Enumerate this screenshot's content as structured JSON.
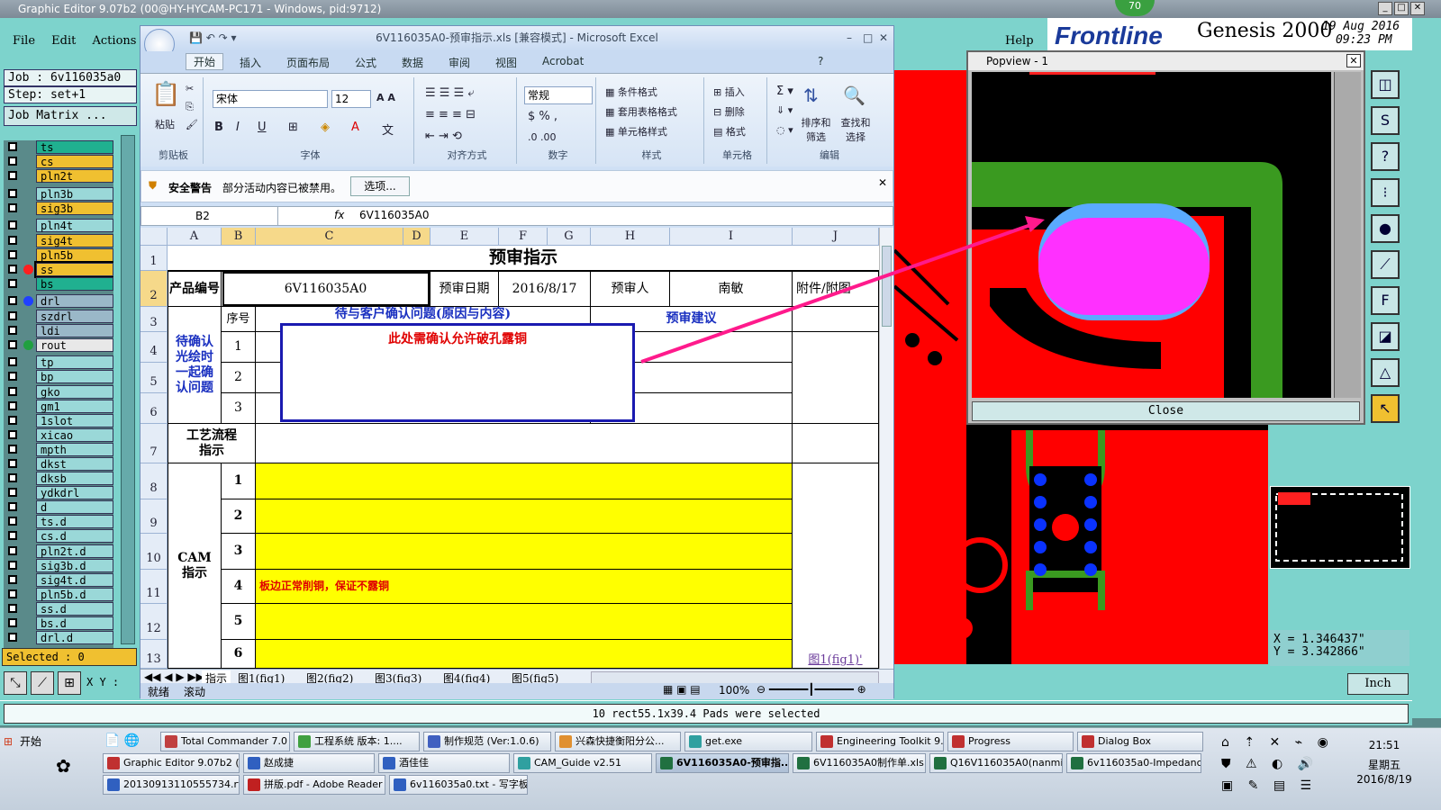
{
  "genesis": {
    "title": "Graphic Editor 9.07b2 (00@HY-HYCAM-PC171 - Windows, pid:9712)",
    "menu": [
      "File",
      "Edit",
      "Actions"
    ],
    "help": "Help",
    "job": "Job : 6v116035a0",
    "step": "Step: set+1",
    "job_matrix": "Job Matrix ...",
    "brand": "Frontline",
    "product": "Genesis 2000",
    "date": "19 Aug 2016",
    "time": "09:23 PM",
    "badge": "70",
    "layers": [
      {
        "name": "ts",
        "color": "#20b090"
      },
      {
        "name": "cs",
        "color": "#f0c030"
      },
      {
        "name": "pln2t",
        "color": "#f0c030"
      },
      {
        "name": "pln3b",
        "color": "#9ad8d8"
      },
      {
        "name": "sig3b",
        "color": "#f0c030"
      },
      {
        "name": "pln4t",
        "color": "#9ad8d8"
      },
      {
        "name": "sig4t",
        "color": "#f0c030"
      },
      {
        "name": "pln5b",
        "color": "#f0c030"
      },
      {
        "name": "ss",
        "color": "#f0c030",
        "dot": "#ff2020",
        "selected": true
      },
      {
        "name": "bs",
        "color": "#20b090"
      },
      {
        "name": "drl",
        "color": "#9ab8c8",
        "dot": "#2040ff"
      },
      {
        "name": "szdrl",
        "color": "#9ab8c8"
      },
      {
        "name": "ldi",
        "color": "#9ab8c8"
      },
      {
        "name": "rout",
        "color": "#e8e8e8",
        "dot": "#20a040"
      },
      {
        "name": "tp",
        "color": "#9ad8d8"
      },
      {
        "name": "bp",
        "color": "#9ad8d8"
      },
      {
        "name": "gko",
        "color": "#9ad8d8"
      },
      {
        "name": "gm1",
        "color": "#9ad8d8"
      },
      {
        "name": "1slot",
        "color": "#9ad8d8"
      },
      {
        "name": "xicao",
        "color": "#9ad8d8"
      },
      {
        "name": "mpth",
        "color": "#9ad8d8"
      },
      {
        "name": "dkst",
        "color": "#9ad8d8"
      },
      {
        "name": "dksb",
        "color": "#9ad8d8"
      },
      {
        "name": "ydkdrl",
        "color": "#9ad8d8"
      },
      {
        "name": "d",
        "color": "#9ad8d8"
      },
      {
        "name": "ts.d",
        "color": "#9ad8d8"
      },
      {
        "name": "cs.d",
        "color": "#9ad8d8"
      },
      {
        "name": "pln2t.d",
        "color": "#9ad8d8"
      },
      {
        "name": "sig3b.d",
        "color": "#9ad8d8"
      },
      {
        "name": "sig4t.d",
        "color": "#9ad8d8"
      },
      {
        "name": "pln5b.d",
        "color": "#9ad8d8"
      },
      {
        "name": "ss.d",
        "color": "#9ad8d8"
      },
      {
        "name": "bs.d",
        "color": "#9ad8d8"
      },
      {
        "name": "drl.d",
        "color": "#9ad8d8"
      }
    ],
    "selected": "Selected : 0",
    "xy_label": "X Y :",
    "popview_title": "Popview - 1",
    "popview_close": "Close",
    "coord_x": "X = 1.346437\"",
    "coord_y": "Y = 3.342866\"",
    "units": "Inch",
    "status_msg": "10 rect55.1x39.4 Pads were selected"
  },
  "excel": {
    "title": "6V116035A0-预审指示.xls  [兼容模式] - Microsoft Excel",
    "tabs": [
      "开始",
      "插入",
      "页面布局",
      "公式",
      "数据",
      "审阅",
      "视图",
      "Acrobat"
    ],
    "groups": [
      "剪贴板",
      "字体",
      "对齐方式",
      "数字",
      "样式",
      "单元格",
      "编辑"
    ],
    "paste": "粘贴",
    "font_name": "宋体",
    "font_size": "12",
    "number_format": "常规",
    "styles": [
      "条件格式",
      "套用表格格式",
      "单元格样式"
    ],
    "cells_btns": [
      "插入",
      "删除",
      "格式"
    ],
    "edit_btns": [
      "排序和筛选",
      "查找和选择"
    ],
    "security_title": "安全警告",
    "security_msg": "部分活动内容已被禁用。",
    "security_btn": "选项...",
    "name_box": "B2",
    "fx": "fx",
    "formula": "6V116035A0",
    "columns": [
      "A",
      "B",
      "C",
      "D",
      "E",
      "F",
      "G",
      "H",
      "I",
      "J"
    ],
    "rows": [
      "1",
      "2",
      "3",
      "4",
      "5",
      "6",
      "7",
      "8",
      "9",
      "10",
      "11",
      "12",
      "13"
    ],
    "sheet_title": "预审指示",
    "r2": {
      "product_label": "产品编号",
      "product": "6V116035A0",
      "date_label": "预审日期",
      "date": "2016/8/17",
      "reviewer_label": "预审人",
      "reviewer": "南敏",
      "attach": "附件/附图"
    },
    "r3": {
      "seq": "序号",
      "issue": "待与客户确认问题(原因与内容)",
      "suggest": "预审建议"
    },
    "confirm_label": "待确认光绘时一起确认问题",
    "seq_a": [
      "1",
      "2",
      "3"
    ],
    "callout": "此处需确认允许破孔露铜",
    "process_label": "工艺流程指示",
    "cam_label": "CAM指示",
    "seq_b": [
      "1",
      "2",
      "3",
      "4",
      "5",
      "6"
    ],
    "cam_note": "板边正常削铜，保证不露铜",
    "fig_link": "图1(fig1)'",
    "sheets": [
      "指示",
      "图1(fig1)",
      "图2(fig2)",
      "图3(fig3)",
      "图4(fig4)",
      "图5(fig5)"
    ],
    "status_ready": "就绪",
    "status_scroll": "滚动",
    "zoom": "100%"
  },
  "taskbar": {
    "start": "开始",
    "row1": [
      "Total Commander 7.0 ...",
      "工程系统  版本: 1....",
      "制作规范 (Ver:1.0.6)",
      "兴森快捷衡阳分公...",
      "get.exe",
      "Engineering Toolkit 9....",
      "Progress",
      "Dialog Box"
    ],
    "row2": [
      "Graphic Editor 9.07b2 (...",
      "赵成捷",
      "酒佳佳",
      "CAM_Guide v2.51",
      "6V116035A0-预审指...",
      "6V116035A0制作单.xls...",
      "Q16V116035A0(nanmin...",
      "6v116035a0-Impedanc..."
    ],
    "row3": [
      "20130913110555734.rtf...",
      "拼版.pdf - Adobe Reader",
      "6v116035a0.txt - 写字板"
    ],
    "clock": "21:51",
    "weekday": "星期五",
    "date": "2016/8/19"
  }
}
